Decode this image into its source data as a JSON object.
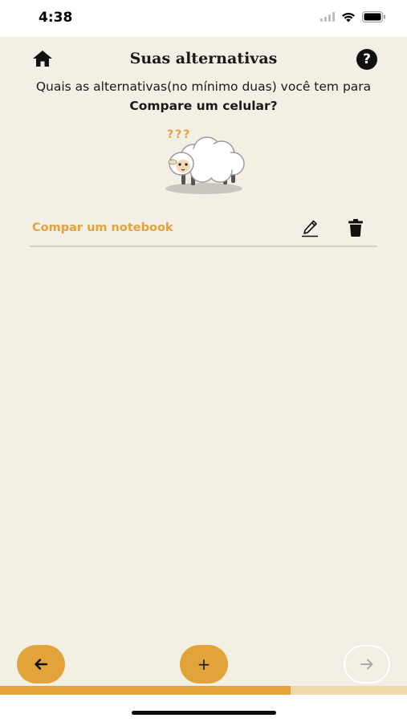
{
  "status_bar": {
    "time": "4:38",
    "icons": [
      "signal-icon",
      "wifi-icon",
      "battery-icon"
    ]
  },
  "header": {
    "title": "Suas alternativas",
    "home_icon": "home-icon",
    "help_label": "?"
  },
  "question": {
    "prefix": "Quais as alternativas(no mínimo duas) você tem para ",
    "subject": "Compare um celular?"
  },
  "illustration": {
    "icon": "confused-sheep-icon",
    "marks": "???"
  },
  "alternatives": [
    {
      "label": "Compar um notebook",
      "edit_icon": "pencil-icon",
      "delete_icon": "trash-icon"
    }
  ],
  "footer": {
    "back_icon": "arrow-left-icon",
    "add_label": "+",
    "next_icon": "arrow-right-icon",
    "progress": 0.714
  },
  "colors": {
    "accent": "#e2a43a",
    "background": "#f3efe4",
    "progress_track": "#f0d9ac"
  }
}
